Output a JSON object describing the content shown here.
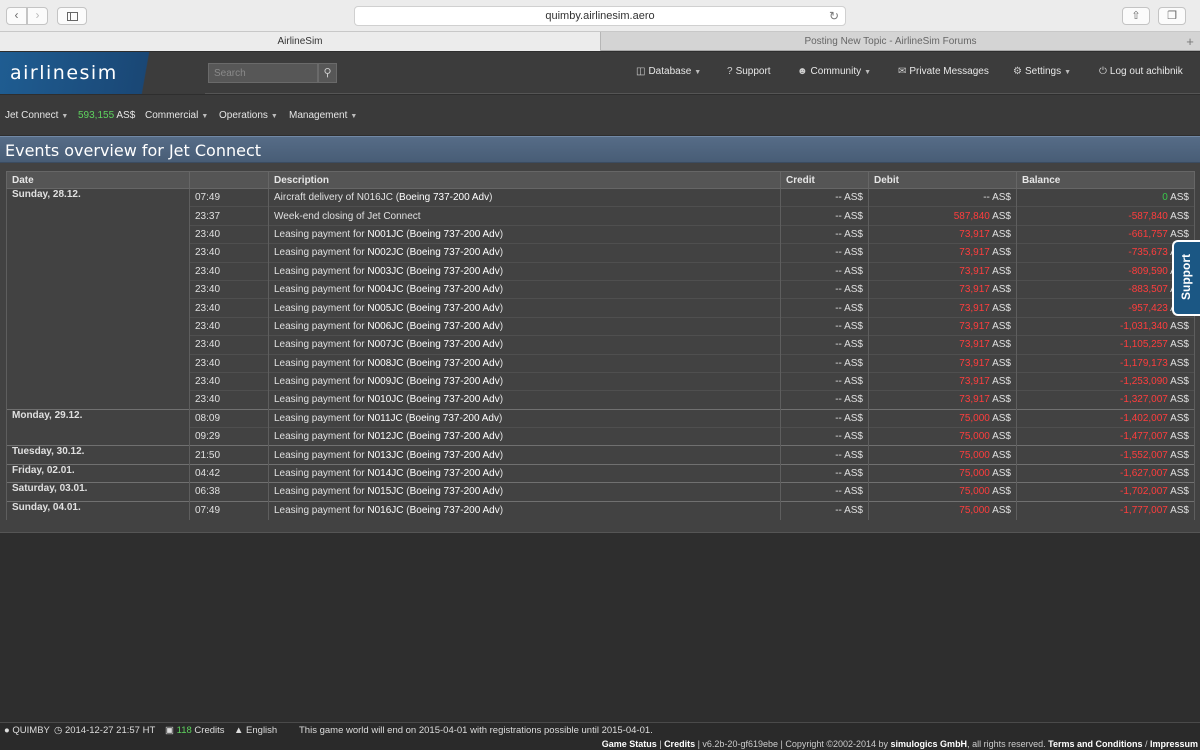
{
  "browser": {
    "url": "quimby.airlinesim.aero",
    "tabs": [
      "AirlineSim",
      "Posting New Topic - AirlineSim Forums"
    ]
  },
  "header": {
    "logo": "airlinesim",
    "search_placeholder": "Search",
    "nav": [
      {
        "label": "Database",
        "icon": "database-icon",
        "has_dropdown": true
      },
      {
        "label": "Support",
        "icon": "question-icon",
        "has_dropdown": false
      },
      {
        "label": "Community",
        "icon": "users-icon",
        "has_dropdown": true
      },
      {
        "label": "Private Messages",
        "icon": "envelope-icon",
        "has_dropdown": false
      },
      {
        "label": "Settings",
        "icon": "gear-icon",
        "has_dropdown": true
      },
      {
        "label": "Log out achibnik",
        "icon": "power-icon",
        "has_dropdown": false
      }
    ]
  },
  "subnav": {
    "airline": "Jet Connect",
    "balance": "593,155",
    "currency": "AS$",
    "items": [
      "Commercial",
      "Operations",
      "Management"
    ]
  },
  "page": {
    "title": "Events overview for Jet Connect"
  },
  "table": {
    "headers": [
      "Date",
      "Description",
      "Credit",
      "Debit",
      "Balance"
    ],
    "days": [
      {
        "date": "Sunday, 28.12.",
        "rows": [
          {
            "time": "07:49",
            "desc_prefix": "Aircraft delivery of N016JC (",
            "aircraft": "Boeing 737-200 Adv",
            "desc_suffix": ")",
            "credit": "-- AS$",
            "debit": "-- AS$",
            "balance": "0",
            "balance_sign": "pos"
          },
          {
            "time": "23:37",
            "desc_prefix": "Week-end closing of Jet Connect",
            "aircraft": "",
            "desc_suffix": "",
            "credit": "-- AS$",
            "debit": "587,840",
            "balance": "-587,840",
            "balance_sign": "neg"
          },
          {
            "time": "23:40",
            "desc_prefix": "Leasing payment for ",
            "reg": "N001JC",
            "aircraft": "Boeing 737-200 Adv",
            "credit": "-- AS$",
            "debit": "73,917",
            "balance": "-661,757",
            "balance_sign": "neg"
          },
          {
            "time": "23:40",
            "desc_prefix": "Leasing payment for ",
            "reg": "N002JC",
            "aircraft": "Boeing 737-200 Adv",
            "credit": "-- AS$",
            "debit": "73,917",
            "balance": "-735,673",
            "balance_sign": "neg"
          },
          {
            "time": "23:40",
            "desc_prefix": "Leasing payment for ",
            "reg": "N003JC",
            "aircraft": "Boeing 737-200 Adv",
            "credit": "-- AS$",
            "debit": "73,917",
            "balance": "-809,590",
            "balance_sign": "neg"
          },
          {
            "time": "23:40",
            "desc_prefix": "Leasing payment for ",
            "reg": "N004JC",
            "aircraft": "Boeing 737-200 Adv",
            "credit": "-- AS$",
            "debit": "73,917",
            "balance": "-883,507",
            "balance_sign": "neg"
          },
          {
            "time": "23:40",
            "desc_prefix": "Leasing payment for ",
            "reg": "N005JC",
            "aircraft": "Boeing 737-200 Adv",
            "credit": "-- AS$",
            "debit": "73,917",
            "balance": "-957,423",
            "balance_sign": "neg"
          },
          {
            "time": "23:40",
            "desc_prefix": "Leasing payment for ",
            "reg": "N006JC",
            "aircraft": "Boeing 737-200 Adv",
            "credit": "-- AS$",
            "debit": "73,917",
            "balance": "-1,031,340",
            "balance_sign": "neg"
          },
          {
            "time": "23:40",
            "desc_prefix": "Leasing payment for ",
            "reg": "N007JC",
            "aircraft": "Boeing 737-200 Adv",
            "credit": "-- AS$",
            "debit": "73,917",
            "balance": "-1,105,257",
            "balance_sign": "neg"
          },
          {
            "time": "23:40",
            "desc_prefix": "Leasing payment for ",
            "reg": "N008JC",
            "aircraft": "Boeing 737-200 Adv",
            "credit": "-- AS$",
            "debit": "73,917",
            "balance": "-1,179,173",
            "balance_sign": "neg"
          },
          {
            "time": "23:40",
            "desc_prefix": "Leasing payment for ",
            "reg": "N009JC",
            "aircraft": "Boeing 737-200 Adv",
            "credit": "-- AS$",
            "debit": "73,917",
            "balance": "-1,253,090",
            "balance_sign": "neg"
          },
          {
            "time": "23:40",
            "desc_prefix": "Leasing payment for ",
            "reg": "N010JC",
            "aircraft": "Boeing 737-200 Adv",
            "credit": "-- AS$",
            "debit": "73,917",
            "balance": "-1,327,007",
            "balance_sign": "neg"
          }
        ]
      },
      {
        "date": "Monday, 29.12.",
        "rows": [
          {
            "time": "08:09",
            "desc_prefix": "Leasing payment for ",
            "reg": "N011JC",
            "aircraft": "Boeing 737-200 Adv",
            "credit": "-- AS$",
            "debit": "75,000",
            "balance": "-1,402,007",
            "balance_sign": "neg"
          },
          {
            "time": "09:29",
            "desc_prefix": "Leasing payment for ",
            "reg": "N012JC",
            "aircraft": "Boeing 737-200 Adv",
            "credit": "-- AS$",
            "debit": "75,000",
            "balance": "-1,477,007",
            "balance_sign": "neg"
          }
        ]
      },
      {
        "date": "Tuesday, 30.12.",
        "rows": [
          {
            "time": "21:50",
            "desc_prefix": "Leasing payment for ",
            "reg": "N013JC",
            "aircraft": "Boeing 737-200 Adv",
            "credit": "-- AS$",
            "debit": "75,000",
            "balance": "-1,552,007",
            "balance_sign": "neg"
          }
        ]
      },
      {
        "date": "Friday, 02.01.",
        "rows": [
          {
            "time": "04:42",
            "desc_prefix": "Leasing payment for ",
            "reg": "N014JC",
            "aircraft": "Boeing 737-200 Adv",
            "credit": "-- AS$",
            "debit": "75,000",
            "balance": "-1,627,007",
            "balance_sign": "neg"
          }
        ]
      },
      {
        "date": "Saturday, 03.01.",
        "rows": [
          {
            "time": "06:38",
            "desc_prefix": "Leasing payment for ",
            "reg": "N015JC",
            "aircraft": "Boeing 737-200 Adv",
            "credit": "-- AS$",
            "debit": "75,000",
            "balance": "-1,702,007",
            "balance_sign": "neg"
          }
        ]
      },
      {
        "date": "Sunday, 04.01.",
        "rows": [
          {
            "time": "07:49",
            "desc_prefix": "Leasing payment for ",
            "reg": "N016JC",
            "aircraft": "Boeing 737-200 Adv",
            "credit": "-- AS$",
            "debit": "75,000",
            "balance": "-1,777,007",
            "balance_sign": "neg"
          }
        ]
      }
    ]
  },
  "support_tab": "Support",
  "status": {
    "world": "QUIMBY",
    "time": "2014-12-27 21:57 HT",
    "credits_count": "118",
    "credits_label": "Credits",
    "language": "English",
    "notice": "This game world will end on 2015-04-01 with registrations possible until 2015-04-01."
  },
  "footer": {
    "game_status": "Game Status",
    "credits": "Credits",
    "version": "v6.2b-20-gf619ebe",
    "copyright": "Copyright ©2002-2014 by",
    "company": "simulogics GmbH",
    "rights": ", all rights reserved.",
    "terms": "Terms and Conditions",
    "impressum": "Impressum"
  },
  "colors": {
    "accent": "#1f5d92",
    "title_bar": "#566c87",
    "positive": "#39c84a",
    "negative": "#ff3d3d"
  }
}
